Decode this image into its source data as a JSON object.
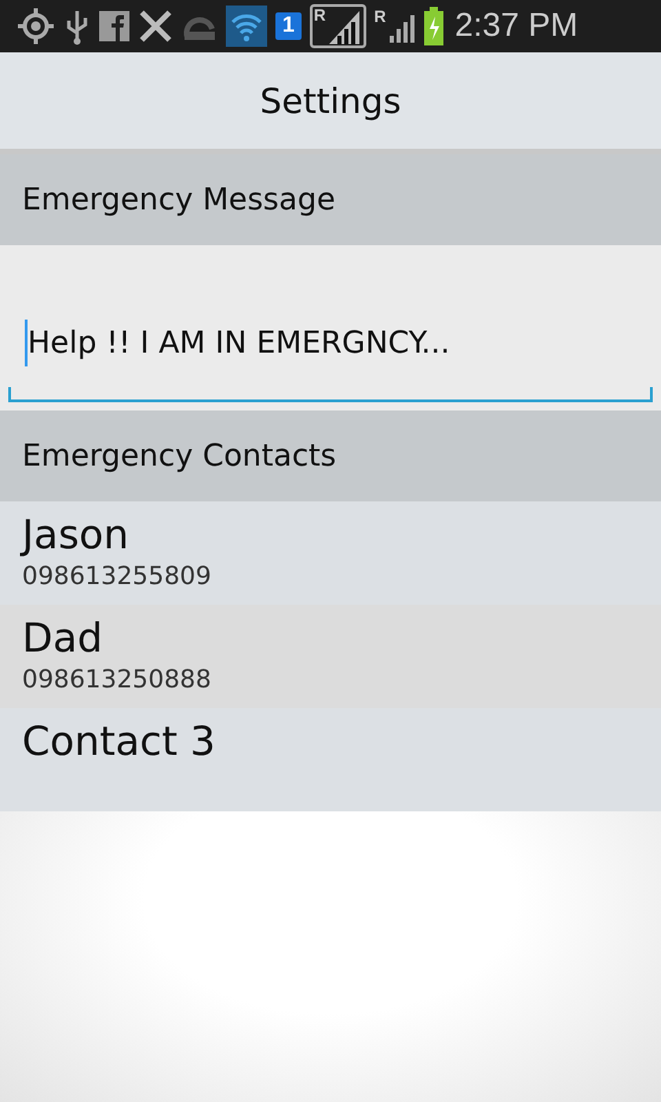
{
  "status_bar": {
    "sim_slot": "1",
    "roaming_1": "R",
    "roaming_2": "R",
    "time": "2:37 PM"
  },
  "window": {
    "title": "Settings"
  },
  "message_section": {
    "header": "Emergency Message",
    "value": "Help !! I AM IN EMERGNCY..."
  },
  "contacts_section": {
    "header": "Emergency Contacts",
    "contacts": [
      {
        "name": "Jason",
        "phone": "098613255809"
      },
      {
        "name": "Dad",
        "phone": "098613250888"
      },
      {
        "name": "Contact 3"
      }
    ]
  }
}
